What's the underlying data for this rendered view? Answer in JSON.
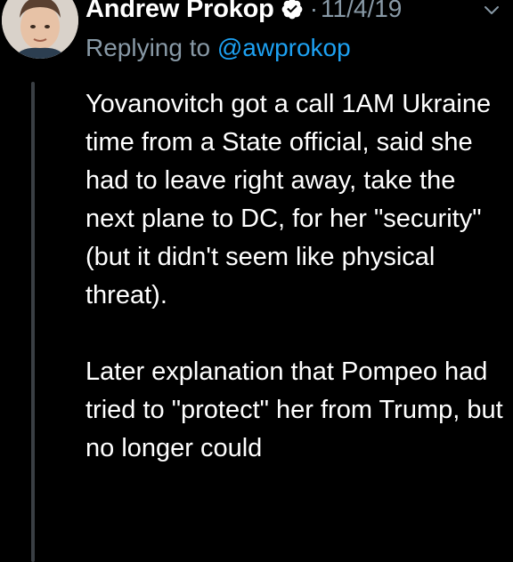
{
  "tweet": {
    "author_name": "Andrew Prokop",
    "separator": "·",
    "timestamp": "11/4/19",
    "reply_prefix": "Replying to ",
    "reply_handle": "@awprokop",
    "paragraphs": [
      "Yovanovitch got a call 1AM Ukraine time from a State official, said she had to leave right away, take the next plane to DC, for her \"security\" (but it didn't seem like physical threat).",
      "Later explanation that Pompeo had tried to \"protect\" her from Trump, but no longer could"
    ]
  },
  "icons": {
    "verified": "verified-badge-icon",
    "caret": "chevron-down-icon",
    "avatar": "avatar-photo"
  },
  "colors": {
    "background": "#000000",
    "text": "#ffffff",
    "secondary_text": "#8899a6",
    "link": "#1da1f2",
    "thread_line": "#3a3f44"
  }
}
